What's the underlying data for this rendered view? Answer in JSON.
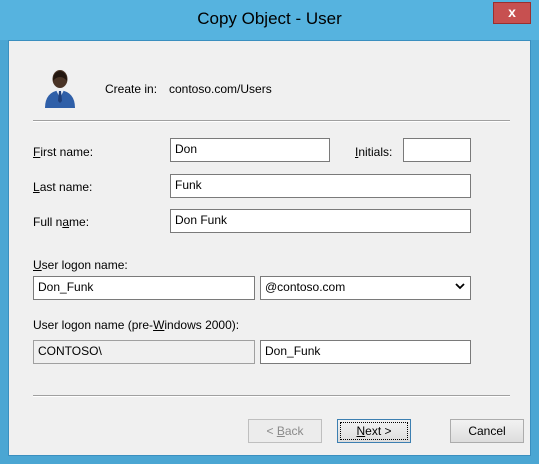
{
  "window": {
    "title": "Copy Object - User",
    "close_glyph": "x"
  },
  "header": {
    "create_in_label": "Create in:",
    "create_in_value": "contoso.com/Users",
    "icon": "user-icon"
  },
  "form": {
    "first_name": {
      "prefix": "F",
      "rest": "irst name:",
      "value": "Don"
    },
    "initials": {
      "prefix": "I",
      "rest": "nitials:",
      "value": ""
    },
    "last_name": {
      "prefix": "L",
      "rest": "ast name:",
      "value": "Funk"
    },
    "full_name": {
      "before": "Full n",
      "accel": "a",
      "after": "me:",
      "value": "Don Funk"
    },
    "logon_name": {
      "prefix": "U",
      "rest": "ser logon name:",
      "value": "Don_Funk",
      "domain": "@contoso.com"
    },
    "pre2000": {
      "before": "User logon name (pre-",
      "accel": "W",
      "after": "indows 2000):",
      "domain_value": "CONTOSO\\",
      "value": "Don_Funk"
    }
  },
  "buttons": {
    "back": {
      "before": "< ",
      "accel": "B",
      "after": "ack"
    },
    "next": {
      "accel": "N",
      "after": "ext >"
    },
    "cancel": "Cancel"
  },
  "colors": {
    "titlebar": "#56b3df",
    "client": "#f0f0f0",
    "close": "#c75050"
  }
}
